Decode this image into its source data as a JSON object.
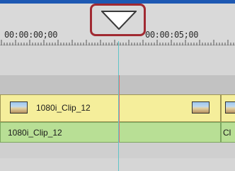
{
  "ruler": {
    "timecode_start": "00:00:00;00",
    "timecode_mid": "00:00:05;00"
  },
  "tracks": {
    "video_clip": {
      "label": "1080i_Clip_12",
      "thumbnail": "beach-thumbnail-icon"
    },
    "audio_clip": {
      "label": "1080i_Clip_12"
    },
    "next_audio_clip": {
      "label": "Cl"
    }
  },
  "colors": {
    "window_titlebar": "#1e59b3",
    "video_clip": "#f5ee9b",
    "audio_clip": "#b8df95",
    "playhead_line": "#5fc4c8",
    "highlight_frame": "#a12a32"
  }
}
